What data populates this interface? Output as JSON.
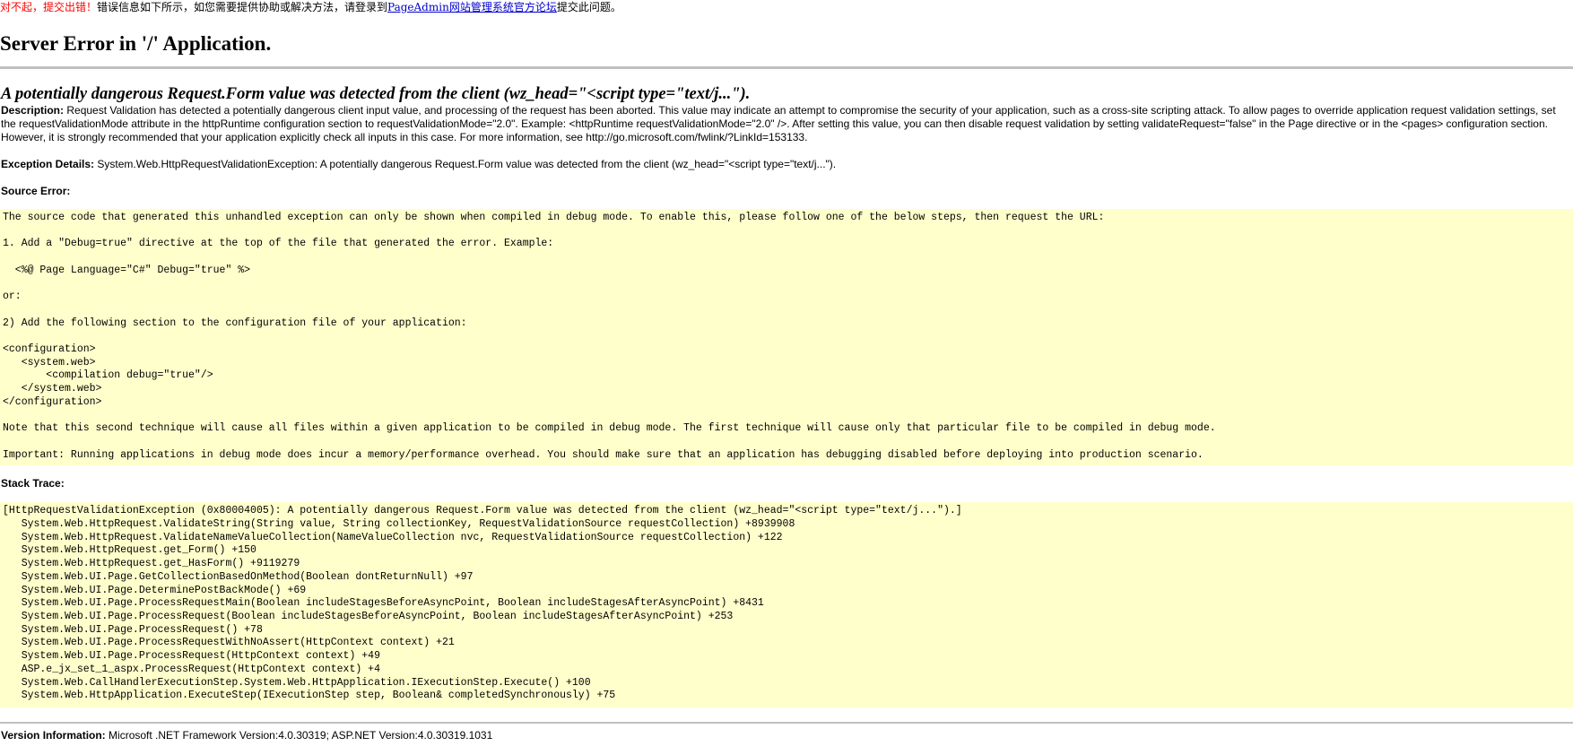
{
  "notice": {
    "sorry": "对不起，",
    "error": "提交出错！",
    "message": "错误信息如下所示，如您需要提供协助或解决方法，请登录到",
    "link_text": "PageAdmin网站管理系统官方论坛",
    "suffix": "提交此问题。"
  },
  "page_title": "Server Error in '/' Application.",
  "error_title": "A potentially dangerous Request.Form value was detected from the client (wz_head=\"<script type=\"text/j...\").",
  "description": {
    "label": "Description:",
    "text": "Request Validation has detected a potentially dangerous client input value, and processing of the request has been aborted. This value may indicate an attempt to compromise the security of your application, such as a cross-site scripting attack. To allow pages to override application request validation settings, set the requestValidationMode attribute in the httpRuntime configuration section to requestValidationMode=\"2.0\". Example: <httpRuntime requestValidationMode=\"2.0\" />. After setting this value, you can then disable request validation by setting validateRequest=\"false\" in the Page directive or in the <pages> configuration section. However, it is strongly recommended that your application explicitly check all inputs in this case. For more information, see http://go.microsoft.com/fwlink/?LinkId=153133."
  },
  "exception_details": {
    "label": "Exception Details:",
    "text": "System.Web.HttpRequestValidationException: A potentially dangerous Request.Form value was detected from the client (wz_head=\"<script type=\"text/j...\")."
  },
  "source_error": {
    "label": "Source Error:",
    "code": "The source code that generated this unhandled exception can only be shown when compiled in debug mode. To enable this, please follow one of the below steps, then request the URL:\n\n1. Add a \"Debug=true\" directive at the top of the file that generated the error. Example:\n\n  <%@ Page Language=\"C#\" Debug=\"true\" %>\n\nor:\n\n2) Add the following section to the configuration file of your application:\n\n<configuration>\n   <system.web>\n       <compilation debug=\"true\"/>\n   </system.web>\n</configuration>\n\nNote that this second technique will cause all files within a given application to be compiled in debug mode. The first technique will cause only that particular file to be compiled in debug mode.\n\nImportant: Running applications in debug mode does incur a memory/performance overhead. You should make sure that an application has debugging disabled before deploying into production scenario."
  },
  "stack_trace": {
    "label": "Stack Trace:",
    "code": "[HttpRequestValidationException (0x80004005): A potentially dangerous Request.Form value was detected from the client (wz_head=\"<script type=\"text/j...\").]\n   System.Web.HttpRequest.ValidateString(String value, String collectionKey, RequestValidationSource requestCollection) +8939908\n   System.Web.HttpRequest.ValidateNameValueCollection(NameValueCollection nvc, RequestValidationSource requestCollection) +122\n   System.Web.HttpRequest.get_Form() +150\n   System.Web.HttpRequest.get_HasForm() +9119279\n   System.Web.UI.Page.GetCollectionBasedOnMethod(Boolean dontReturnNull) +97\n   System.Web.UI.Page.DeterminePostBackMode() +69\n   System.Web.UI.Page.ProcessRequestMain(Boolean includeStagesBeforeAsyncPoint, Boolean includeStagesAfterAsyncPoint) +8431\n   System.Web.UI.Page.ProcessRequest(Boolean includeStagesBeforeAsyncPoint, Boolean includeStagesAfterAsyncPoint) +253\n   System.Web.UI.Page.ProcessRequest() +78\n   System.Web.UI.Page.ProcessRequestWithNoAssert(HttpContext context) +21\n   System.Web.UI.Page.ProcessRequest(HttpContext context) +49\n   ASP.e_jx_set_1_aspx.ProcessRequest(HttpContext context) +4\n   System.Web.CallHandlerExecutionStep.System.Web.HttpApplication.IExecutionStep.Execute() +100\n   System.Web.HttpApplication.ExecuteStep(IExecutionStep step, Boolean& completedSynchronously) +75"
  },
  "version_information": {
    "label": "Version Information:",
    "text": "Microsoft .NET Framework Version:4.0.30319; ASP.NET Version:4.0.30319.1031"
  },
  "colors": {
    "code_background": "#ffffcc",
    "notice_red": "#ff0000",
    "link_blue": "#0000cc",
    "rule_gray": "#c0c0c0"
  }
}
